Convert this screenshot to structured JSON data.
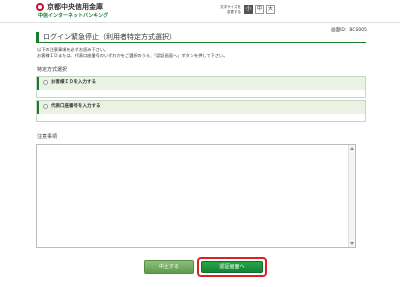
{
  "header": {
    "bank_name": "京都中央信用金庫",
    "service_name": "中信インターネットバンキング",
    "font_size_label_1": "文字サイズを",
    "font_size_label_2": "変更する",
    "font_sizes": [
      "小",
      "中",
      "大"
    ]
  },
  "screen_id": "画面ID：BCS005",
  "page_title": "ログイン緊急停止（利用者特定方式選択）",
  "instructions": [
    "以下の注意事項を必ずお読み下さい。",
    "お客様ＩＤまたは、代表口座番号のいずれかをご選択のうえ、「認証画面へ」ボタンを押して下さい。"
  ],
  "method_section": {
    "title": "特定方式選択",
    "options": [
      {
        "label": "お客様ＩＤを入力する"
      },
      {
        "label": "代表口座番号を入力する"
      }
    ]
  },
  "notes_section": {
    "title": "注意事項",
    "content": ""
  },
  "buttons": {
    "cancel": "中止する",
    "next": "認証画面へ"
  }
}
